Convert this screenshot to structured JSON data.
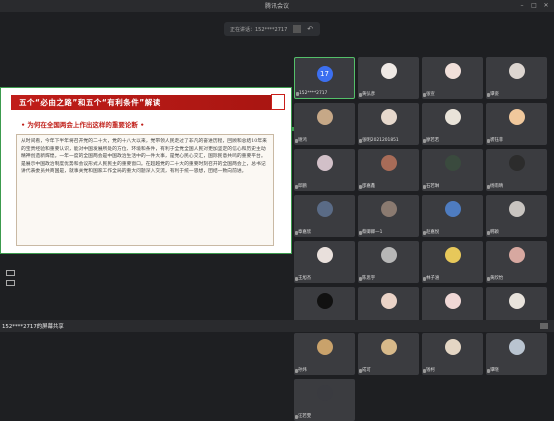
{
  "window": {
    "title": "腾讯会议"
  },
  "speaking": {
    "label": "正在讲话：152****2717",
    "back_icon": "back-arrow-icon"
  },
  "slide": {
    "heading": "五个“必由之路”和五个“有利条件”解读",
    "subtitle": "• 为何在全国两会上作出这样的重要论断 •",
    "body": "从时间看，今年下半年将召开党的二十大，党的十八大以来，党带领人民走过了非凡的奋进历程，回顾和总结10年来的宝贵经验和重要认识，能对中国发展所处的方位、环境和条件，有利于全党全国人民对更加坚定的信心和历史主动精神创造新辉煌。一年一度的全国两会是中国政治生活中的一件大事，是党心民心交汇，国际民意共鸣的重要平台。是展示中国政治制度优势和会议形式人民民主的重要窗口。在超越党的二十大的重要时刻召开的全国两会上，总书记讲代表委员共商国是，就事关党和国家工作全局的重大问题深入交流，有利于统一思想，团结一致向前进。"
  },
  "participants": [
    {
      "name": "152****2717",
      "self": true,
      "badge": "17"
    },
    {
      "name": "黄弘彦",
      "color": "#efe9e5"
    },
    {
      "name": "张宣",
      "color": "#f1e0da"
    },
    {
      "name": "谭姿",
      "color": "#dcd5d0"
    },
    {
      "name": "谢鸿",
      "color": "#c6a887"
    },
    {
      "name": "张明2021201851",
      "color": "#e6d8cc"
    },
    {
      "name": "廖若若",
      "color": "#e9e3d9"
    },
    {
      "name": "裘钰菲",
      "color": "#f0c89c"
    },
    {
      "name": "邱鹏",
      "color": "#d2c0c8"
    },
    {
      "name": "邵嘉鑫",
      "color": "#a86c58"
    },
    {
      "name": "石若琳",
      "color": "#3a4a3e"
    },
    {
      "name": "杨雨晴",
      "color": "#2c2c2c"
    },
    {
      "name": "章嘉欣",
      "color": "#5a6b86"
    },
    {
      "name": "蔡卿卿一1",
      "color": "#8a7a70"
    },
    {
      "name": "赵嘉悦",
      "color": "#4e7cc0"
    },
    {
      "name": "韩颖",
      "color": "#c8c4c0"
    },
    {
      "name": "王旭杰",
      "color": "#e9e0dc"
    },
    {
      "name": "陈思宇",
      "color": "#b7b7b7"
    },
    {
      "name": "林子涵",
      "color": "#e7c85a"
    },
    {
      "name": "黄欣怡",
      "color": "#d7a8a0"
    },
    {
      "name": "赵静怡",
      "color": "#111111"
    },
    {
      "name": "彭琳",
      "color": "#ead3c7"
    },
    {
      "name": "刘文琪",
      "color": "#f0d8d6"
    },
    {
      "name": "周倩",
      "color": "#e8e3dc"
    },
    {
      "name": "孙炜",
      "color": "#c9a26b"
    },
    {
      "name": "成可",
      "color": "#d7b98a"
    },
    {
      "name": "钱柯",
      "color": "#e4d6c4"
    },
    {
      "name": "谭晓",
      "color": "#b9c4d0"
    },
    {
      "name": "汪若雯",
      "color": "#3a3b40"
    }
  ],
  "statusbar": {
    "text": "152****2717的屏幕共享"
  }
}
